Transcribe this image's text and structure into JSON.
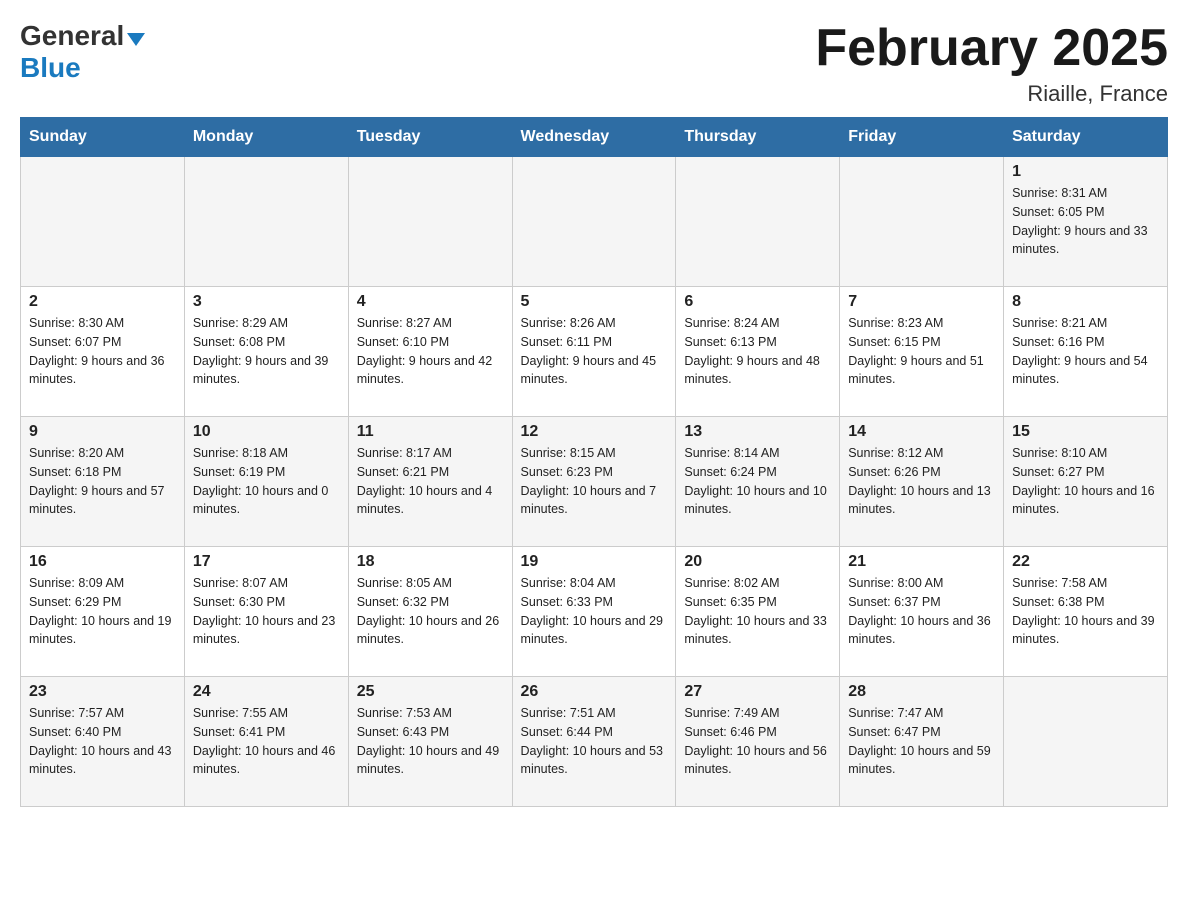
{
  "header": {
    "logo_general": "General",
    "logo_blue": "Blue",
    "month_title": "February 2025",
    "location": "Riaille, France"
  },
  "days_of_week": [
    "Sunday",
    "Monday",
    "Tuesday",
    "Wednesday",
    "Thursday",
    "Friday",
    "Saturday"
  ],
  "weeks": [
    [
      {
        "day": "",
        "sunrise": "",
        "sunset": "",
        "daylight": ""
      },
      {
        "day": "",
        "sunrise": "",
        "sunset": "",
        "daylight": ""
      },
      {
        "day": "",
        "sunrise": "",
        "sunset": "",
        "daylight": ""
      },
      {
        "day": "",
        "sunrise": "",
        "sunset": "",
        "daylight": ""
      },
      {
        "day": "",
        "sunrise": "",
        "sunset": "",
        "daylight": ""
      },
      {
        "day": "",
        "sunrise": "",
        "sunset": "",
        "daylight": ""
      },
      {
        "day": "1",
        "sunrise": "Sunrise: 8:31 AM",
        "sunset": "Sunset: 6:05 PM",
        "daylight": "Daylight: 9 hours and 33 minutes."
      }
    ],
    [
      {
        "day": "2",
        "sunrise": "Sunrise: 8:30 AM",
        "sunset": "Sunset: 6:07 PM",
        "daylight": "Daylight: 9 hours and 36 minutes."
      },
      {
        "day": "3",
        "sunrise": "Sunrise: 8:29 AM",
        "sunset": "Sunset: 6:08 PM",
        "daylight": "Daylight: 9 hours and 39 minutes."
      },
      {
        "day": "4",
        "sunrise": "Sunrise: 8:27 AM",
        "sunset": "Sunset: 6:10 PM",
        "daylight": "Daylight: 9 hours and 42 minutes."
      },
      {
        "day": "5",
        "sunrise": "Sunrise: 8:26 AM",
        "sunset": "Sunset: 6:11 PM",
        "daylight": "Daylight: 9 hours and 45 minutes."
      },
      {
        "day": "6",
        "sunrise": "Sunrise: 8:24 AM",
        "sunset": "Sunset: 6:13 PM",
        "daylight": "Daylight: 9 hours and 48 minutes."
      },
      {
        "day": "7",
        "sunrise": "Sunrise: 8:23 AM",
        "sunset": "Sunset: 6:15 PM",
        "daylight": "Daylight: 9 hours and 51 minutes."
      },
      {
        "day": "8",
        "sunrise": "Sunrise: 8:21 AM",
        "sunset": "Sunset: 6:16 PM",
        "daylight": "Daylight: 9 hours and 54 minutes."
      }
    ],
    [
      {
        "day": "9",
        "sunrise": "Sunrise: 8:20 AM",
        "sunset": "Sunset: 6:18 PM",
        "daylight": "Daylight: 9 hours and 57 minutes."
      },
      {
        "day": "10",
        "sunrise": "Sunrise: 8:18 AM",
        "sunset": "Sunset: 6:19 PM",
        "daylight": "Daylight: 10 hours and 0 minutes."
      },
      {
        "day": "11",
        "sunrise": "Sunrise: 8:17 AM",
        "sunset": "Sunset: 6:21 PM",
        "daylight": "Daylight: 10 hours and 4 minutes."
      },
      {
        "day": "12",
        "sunrise": "Sunrise: 8:15 AM",
        "sunset": "Sunset: 6:23 PM",
        "daylight": "Daylight: 10 hours and 7 minutes."
      },
      {
        "day": "13",
        "sunrise": "Sunrise: 8:14 AM",
        "sunset": "Sunset: 6:24 PM",
        "daylight": "Daylight: 10 hours and 10 minutes."
      },
      {
        "day": "14",
        "sunrise": "Sunrise: 8:12 AM",
        "sunset": "Sunset: 6:26 PM",
        "daylight": "Daylight: 10 hours and 13 minutes."
      },
      {
        "day": "15",
        "sunrise": "Sunrise: 8:10 AM",
        "sunset": "Sunset: 6:27 PM",
        "daylight": "Daylight: 10 hours and 16 minutes."
      }
    ],
    [
      {
        "day": "16",
        "sunrise": "Sunrise: 8:09 AM",
        "sunset": "Sunset: 6:29 PM",
        "daylight": "Daylight: 10 hours and 19 minutes."
      },
      {
        "day": "17",
        "sunrise": "Sunrise: 8:07 AM",
        "sunset": "Sunset: 6:30 PM",
        "daylight": "Daylight: 10 hours and 23 minutes."
      },
      {
        "day": "18",
        "sunrise": "Sunrise: 8:05 AM",
        "sunset": "Sunset: 6:32 PM",
        "daylight": "Daylight: 10 hours and 26 minutes."
      },
      {
        "day": "19",
        "sunrise": "Sunrise: 8:04 AM",
        "sunset": "Sunset: 6:33 PM",
        "daylight": "Daylight: 10 hours and 29 minutes."
      },
      {
        "day": "20",
        "sunrise": "Sunrise: 8:02 AM",
        "sunset": "Sunset: 6:35 PM",
        "daylight": "Daylight: 10 hours and 33 minutes."
      },
      {
        "day": "21",
        "sunrise": "Sunrise: 8:00 AM",
        "sunset": "Sunset: 6:37 PM",
        "daylight": "Daylight: 10 hours and 36 minutes."
      },
      {
        "day": "22",
        "sunrise": "Sunrise: 7:58 AM",
        "sunset": "Sunset: 6:38 PM",
        "daylight": "Daylight: 10 hours and 39 minutes."
      }
    ],
    [
      {
        "day": "23",
        "sunrise": "Sunrise: 7:57 AM",
        "sunset": "Sunset: 6:40 PM",
        "daylight": "Daylight: 10 hours and 43 minutes."
      },
      {
        "day": "24",
        "sunrise": "Sunrise: 7:55 AM",
        "sunset": "Sunset: 6:41 PM",
        "daylight": "Daylight: 10 hours and 46 minutes."
      },
      {
        "day": "25",
        "sunrise": "Sunrise: 7:53 AM",
        "sunset": "Sunset: 6:43 PM",
        "daylight": "Daylight: 10 hours and 49 minutes."
      },
      {
        "day": "26",
        "sunrise": "Sunrise: 7:51 AM",
        "sunset": "Sunset: 6:44 PM",
        "daylight": "Daylight: 10 hours and 53 minutes."
      },
      {
        "day": "27",
        "sunrise": "Sunrise: 7:49 AM",
        "sunset": "Sunset: 6:46 PM",
        "daylight": "Daylight: 10 hours and 56 minutes."
      },
      {
        "day": "28",
        "sunrise": "Sunrise: 7:47 AM",
        "sunset": "Sunset: 6:47 PM",
        "daylight": "Daylight: 10 hours and 59 minutes."
      },
      {
        "day": "",
        "sunrise": "",
        "sunset": "",
        "daylight": ""
      }
    ]
  ]
}
